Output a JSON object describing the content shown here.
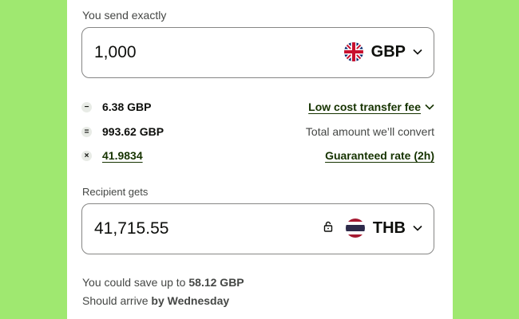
{
  "send": {
    "label": "You send exactly",
    "amount": "1,000",
    "currency": "GBP",
    "flag": "uk-flag-icon"
  },
  "breakdown": {
    "fee": {
      "op": "−",
      "value": "6.38 GBP",
      "link": "Low cost transfer fee"
    },
    "convert": {
      "op": "=",
      "value": "993.62 GBP",
      "text": "Total amount we’ll convert"
    },
    "rate": {
      "op": "×",
      "value": "41.9834",
      "link": "Guaranteed rate (2h)"
    }
  },
  "receive": {
    "label": "Recipient gets",
    "amount": "41,715.55",
    "currency": "THB",
    "flag": "thailand-flag-icon"
  },
  "footer": {
    "save_prefix": "You could save up to",
    "save_amount": "58.12 GBP",
    "arrive_prefix": "Should arrive",
    "arrive_day": "by Wednesday"
  },
  "colors": {
    "background": "#9fe870",
    "panel": "#ffffff",
    "text": "#0e0f0c",
    "link": "#163300"
  }
}
